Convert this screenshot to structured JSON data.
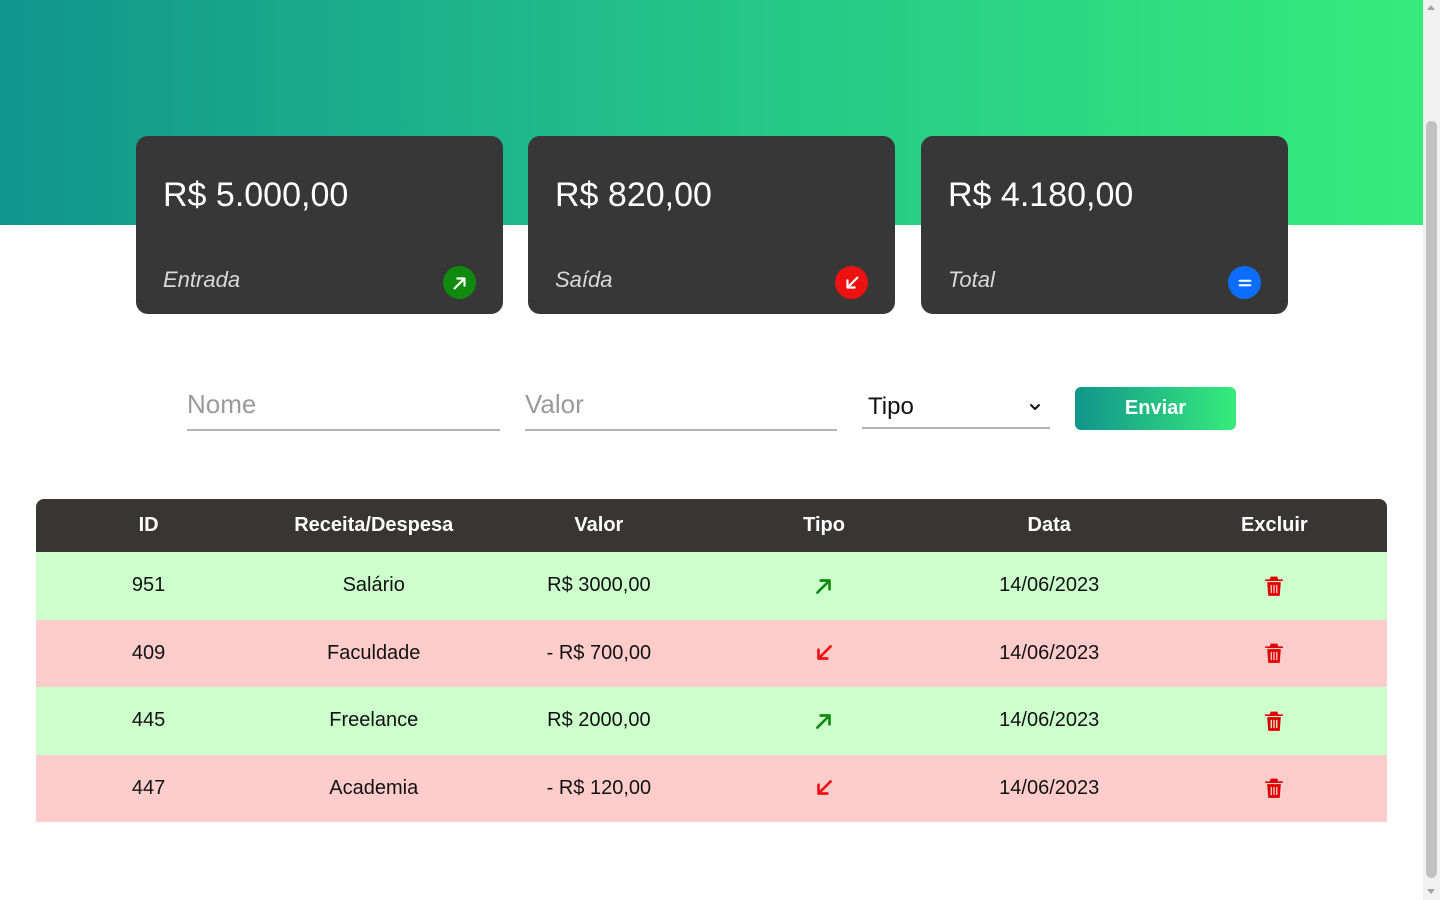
{
  "summary": {
    "entrada": {
      "amount": "R$ 5.000,00",
      "label": "Entrada",
      "icon": "arrow-up-right-icon",
      "color": "#0f8a0f"
    },
    "saida": {
      "amount": "R$ 820,00",
      "label": "Saída",
      "icon": "arrow-down-left-icon",
      "color": "#ee1111"
    },
    "total": {
      "amount": "R$ 4.180,00",
      "label": "Total",
      "icon": "equals-icon",
      "color": "#0d6efd"
    }
  },
  "form": {
    "nome_placeholder": "Nome",
    "valor_placeholder": "Valor",
    "tipo_selected": "Tipo",
    "submit_label": "Enviar"
  },
  "table": {
    "headers": [
      "ID",
      "Receita/Despesa",
      "Valor",
      "Tipo",
      "Data",
      "Excluir"
    ],
    "rows": [
      {
        "id": "951",
        "name": "Salário",
        "value": "R$ 3000,00",
        "type": "entrada",
        "date": "14/06/2023"
      },
      {
        "id": "409",
        "name": "Faculdade",
        "value": "- R$ 700,00",
        "type": "saida",
        "date": "14/06/2023"
      },
      {
        "id": "445",
        "name": "Freelance",
        "value": "R$ 2000,00",
        "type": "entrada",
        "date": "14/06/2023"
      },
      {
        "id": "447",
        "name": "Academia",
        "value": "- R$ 120,00",
        "type": "saida",
        "date": "14/06/2023"
      }
    ]
  },
  "colors": {
    "gradient_start": "#10958c",
    "gradient_end": "#37eb7b",
    "card_bg": "#373737",
    "income_row": "#ccffcc",
    "expense_row": "#ffcccc",
    "income_arrow": "#0f8a0f",
    "expense_arrow": "#ee1111",
    "trash": "#e00000"
  }
}
